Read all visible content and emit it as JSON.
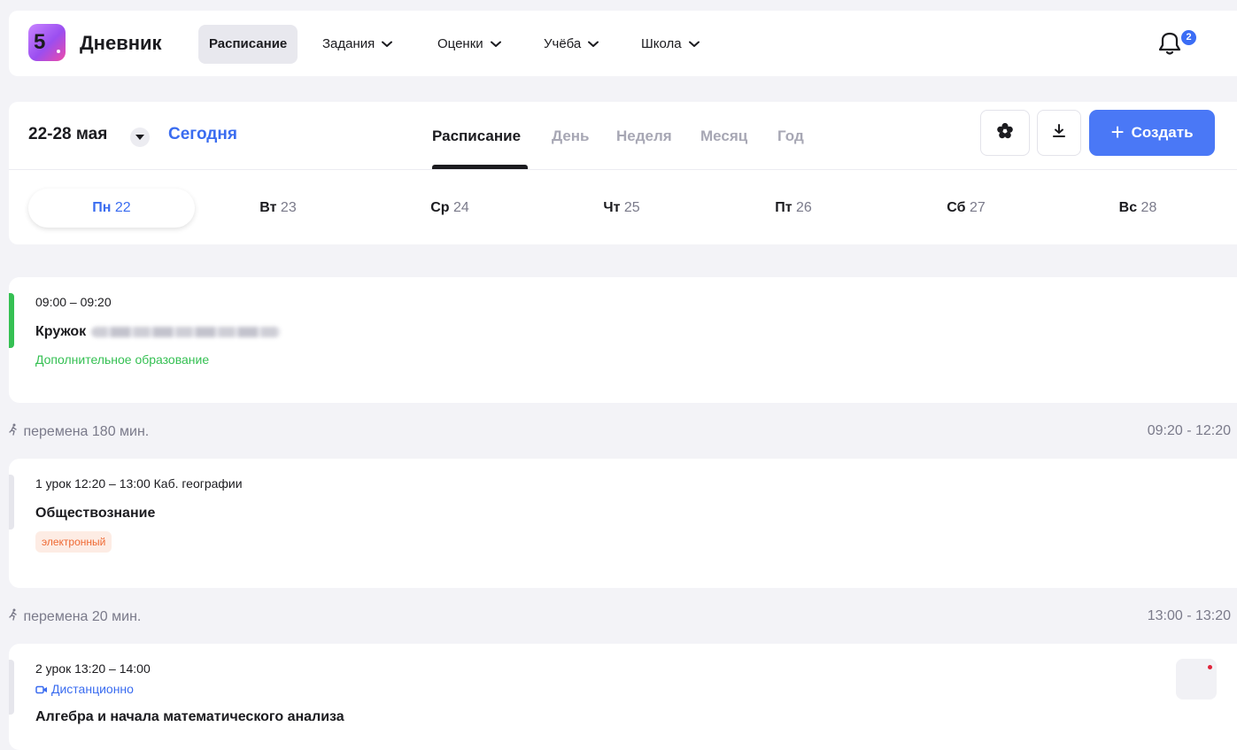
{
  "nav": {
    "logo_text": "5",
    "brand": "Дневник",
    "items": [
      {
        "label": "Расписание",
        "active": true,
        "has_dropdown": false
      },
      {
        "label": "Задания",
        "active": false,
        "has_dropdown": true
      },
      {
        "label": "Оценки",
        "active": false,
        "has_dropdown": true
      },
      {
        "label": "Учёба",
        "active": false,
        "has_dropdown": true
      },
      {
        "label": "Школа",
        "active": false,
        "has_dropdown": true
      }
    ],
    "notifications_count": "2",
    "notifications_icon": "bell-icon"
  },
  "schedule_header": {
    "range": "22-28 мая",
    "today_label": "Сегодня",
    "view_tabs": [
      {
        "label": "Расписание",
        "active": true
      },
      {
        "label": "День",
        "active": false
      },
      {
        "label": "Неделя",
        "active": false
      },
      {
        "label": "Месяц",
        "active": false
      },
      {
        "label": "Год",
        "active": false
      }
    ],
    "settings_icon": "flower-settings-icon",
    "download_icon": "download-icon",
    "create_label": "Создать",
    "days": [
      {
        "dow": "Пн",
        "num": "22",
        "active": true
      },
      {
        "dow": "Вт",
        "num": "23",
        "active": false
      },
      {
        "dow": "Ср",
        "num": "24",
        "active": false
      },
      {
        "dow": "Чт",
        "num": "25",
        "active": false
      },
      {
        "dow": "Пт",
        "num": "26",
        "active": false
      },
      {
        "dow": "Сб",
        "num": "27",
        "active": false
      },
      {
        "dow": "Вс",
        "num": "28",
        "active": false
      }
    ]
  },
  "lessons": [
    {
      "time": "09:00 – 09:20",
      "title": "Кружок",
      "subtitle": "Дополнительное образование",
      "accent": "#35c053"
    },
    {
      "time": "1 урок 12:20 – 13:00 Каб. географии",
      "title": "Обществознание",
      "tag": "электронный"
    },
    {
      "time": "2 урок 13:20 – 14:00",
      "mode": "Дистанционно",
      "title": "Алгебра и начала математического анализа"
    }
  ],
  "breaks": [
    {
      "label": "перемена 180 мин.",
      "time": "09:20 - 12:20"
    },
    {
      "label": "перемена 20 мин.",
      "time": "13:00 - 13:20"
    }
  ],
  "colors": {
    "accent_blue": "#3a6cf0",
    "create_button": "#4a78f6",
    "extra_edu_green": "#35c053",
    "tag_orange": "#ef6a34",
    "notify_dot": "#e0253b"
  }
}
